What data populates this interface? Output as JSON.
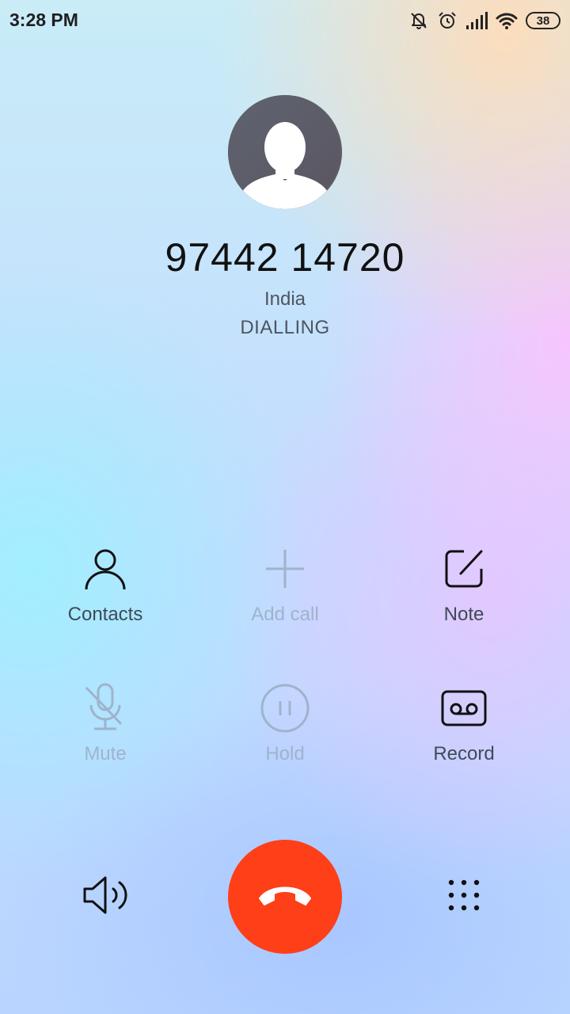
{
  "status_bar": {
    "time": "3:28 PM",
    "battery": "38",
    "icons": [
      "notifications-off-icon",
      "alarm-icon",
      "signal-icon",
      "wifi-icon",
      "battery-icon"
    ]
  },
  "caller": {
    "number": "97442 14720",
    "location": "India",
    "status": "DIALLING"
  },
  "actions": {
    "contacts": {
      "label": "Contacts",
      "icon": "person-icon",
      "enabled": true
    },
    "add_call": {
      "label": "Add call",
      "icon": "plus-icon",
      "enabled": false
    },
    "note": {
      "label": "Note",
      "icon": "note-icon",
      "enabled": true
    },
    "mute": {
      "label": "Mute",
      "icon": "mic-off-icon",
      "enabled": false
    },
    "hold": {
      "label": "Hold",
      "icon": "pause-icon",
      "enabled": false
    },
    "record": {
      "label": "Record",
      "icon": "record-icon",
      "enabled": true
    }
  },
  "bottom": {
    "speaker_icon": "speaker-icon",
    "end_call_icon": "end-call-icon",
    "keypad_icon": "dialpad-icon"
  },
  "colors": {
    "end_call": "#ff3f17",
    "text_primary": "#111111",
    "text_secondary": "#4d5560",
    "text_disabled": "#9fb3cc"
  }
}
